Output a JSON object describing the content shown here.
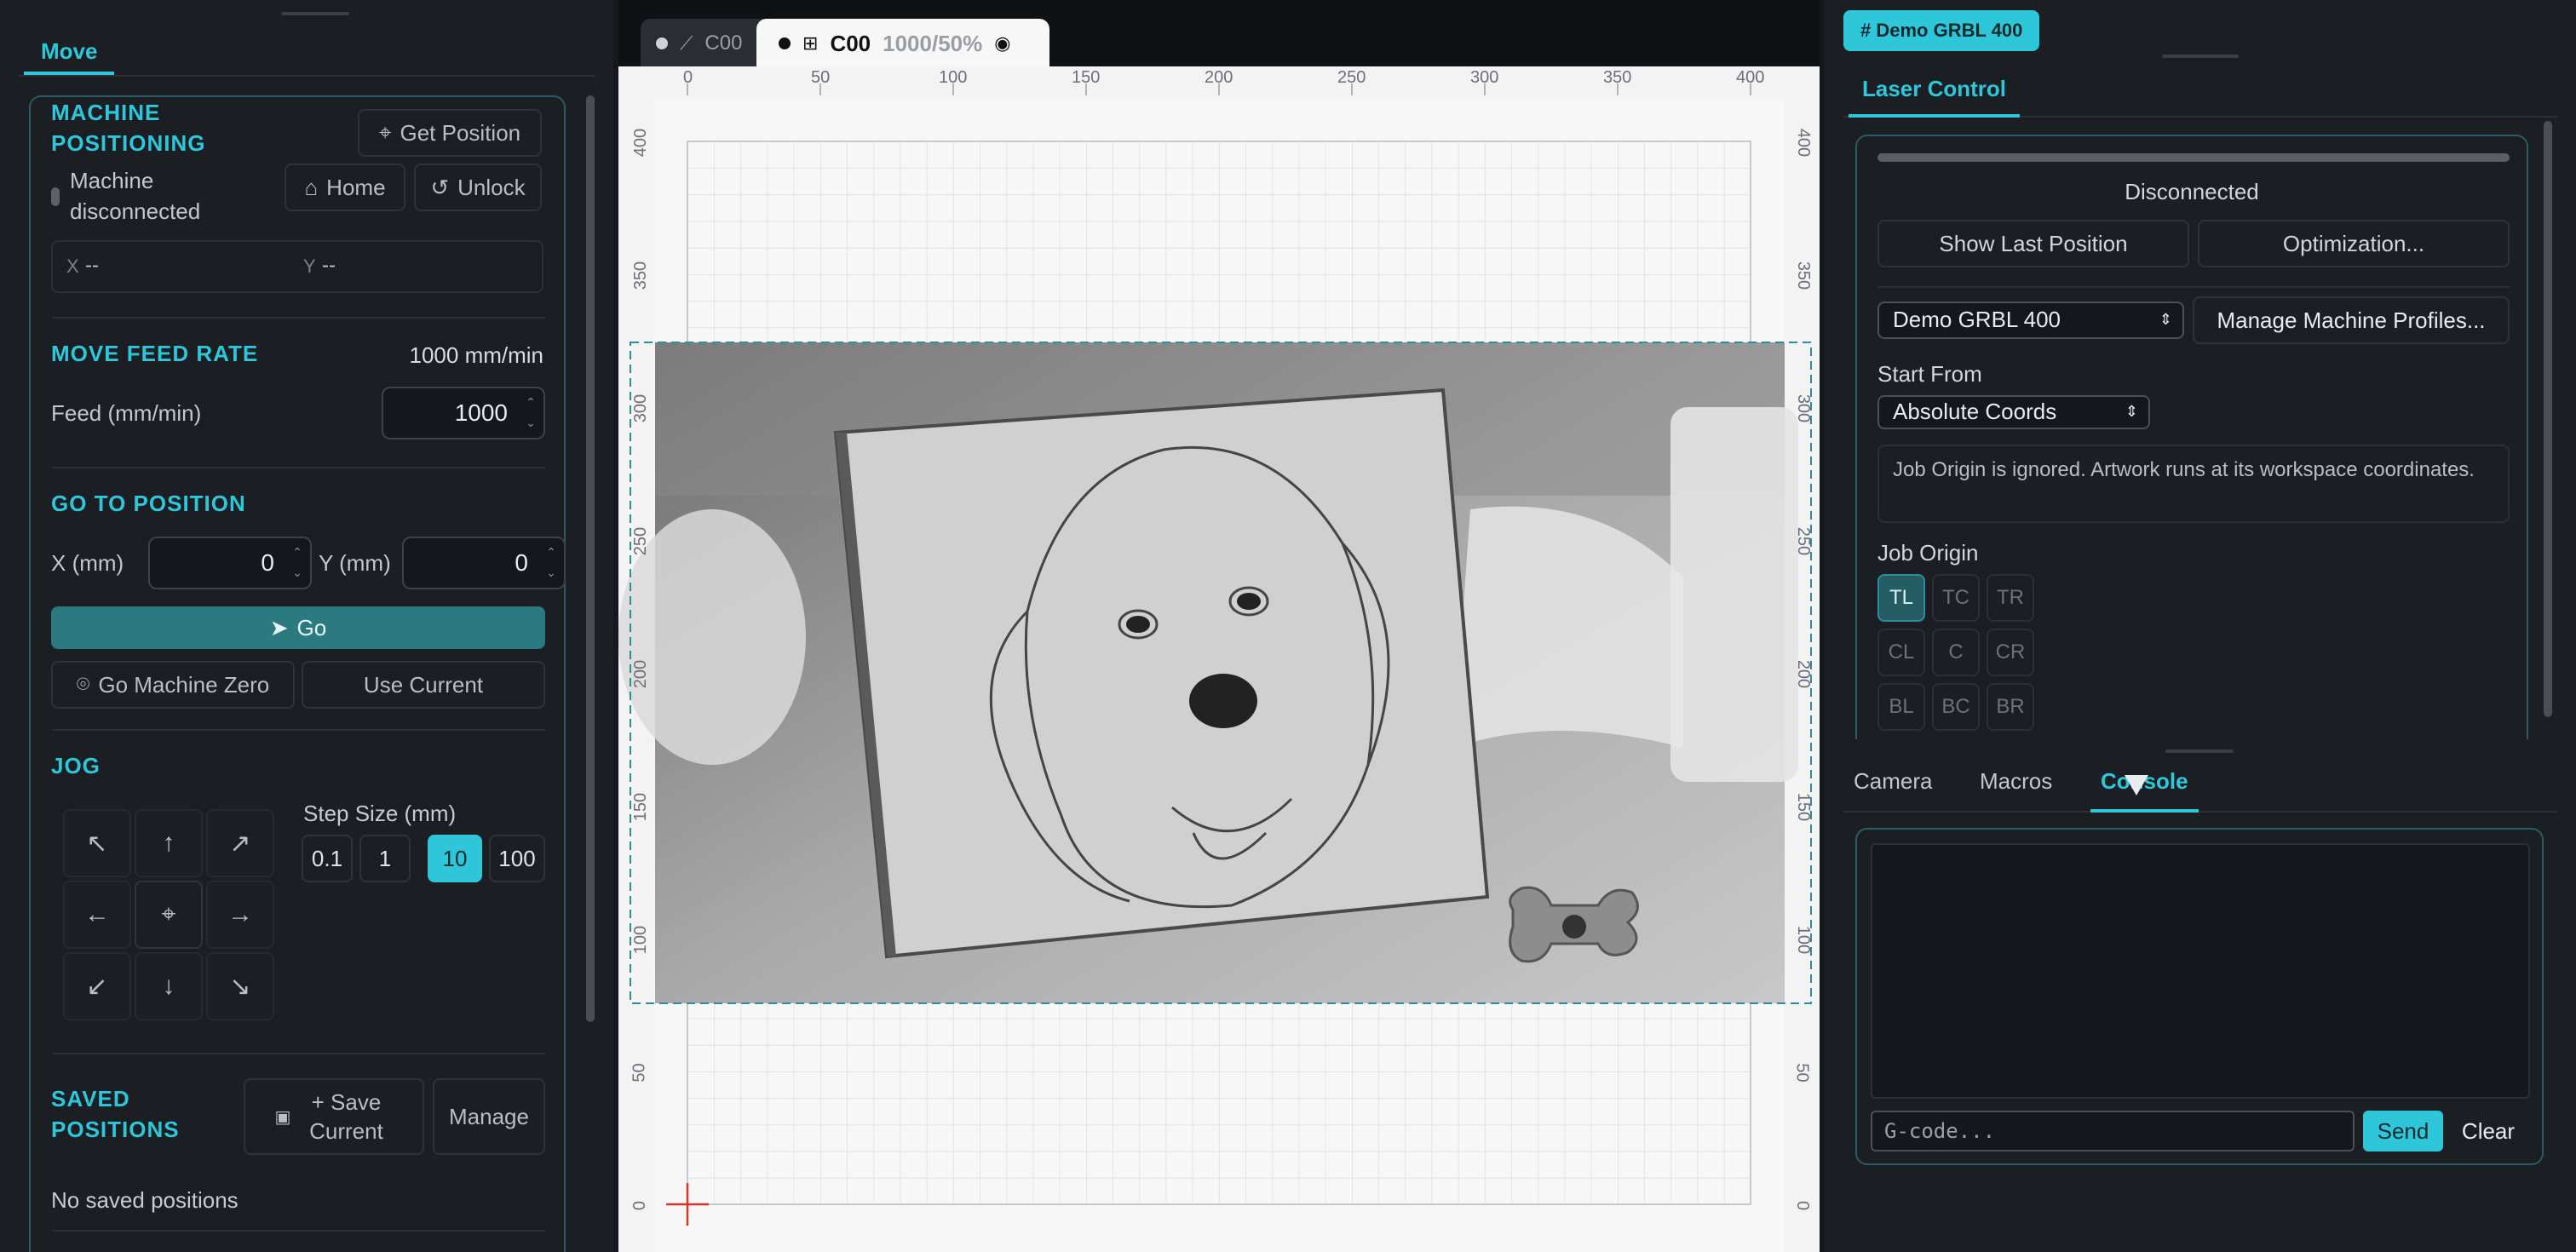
{
  "left": {
    "tab": "Move",
    "machine": {
      "title": "MACHINE POSITIONING",
      "get_position": "Get Position",
      "status": "Machine disconnected",
      "home": "Home",
      "unlock": "Unlock",
      "x_label": "X",
      "x_value": "--",
      "y_label": "Y",
      "y_value": "--"
    },
    "feed": {
      "title": "MOVE FEED RATE",
      "current": "1000 mm/min",
      "label": "Feed (mm/min)",
      "value": "1000"
    },
    "goto": {
      "title": "GO TO POSITION",
      "x_label": "X (mm)",
      "x_value": "0",
      "y_label": "Y (mm)",
      "y_value": "0",
      "go": "Go",
      "go_zero": "Go Machine Zero",
      "use_current": "Use Current"
    },
    "jog": {
      "title": "JOG",
      "step_label": "Step Size (mm)",
      "steps": [
        "0.1",
        "1",
        "10",
        "100"
      ],
      "active_step": "10"
    },
    "saved": {
      "title": "SAVED POSITIONS",
      "save": "+ Save Current",
      "manage": "Manage",
      "empty": "No saved positions"
    }
  },
  "center": {
    "tabs": [
      {
        "label": "C00"
      },
      {
        "label": "C00",
        "info": "1000/50%"
      }
    ],
    "ruler_x": [
      "0",
      "50",
      "100",
      "150",
      "200",
      "250",
      "300",
      "350",
      "400"
    ],
    "ruler_y": [
      "400",
      "350",
      "300",
      "250",
      "200",
      "150",
      "100",
      "50",
      "0"
    ]
  },
  "right": {
    "profile_tag": "# Demo GRBL 400",
    "tab": "Laser Control",
    "status": "Disconnected",
    "show_last": "Show Last Position",
    "optimization": "Optimization...",
    "profile_select": "Demo GRBL 400",
    "manage_profiles": "Manage Machine Profiles...",
    "start_from_label": "Start From",
    "start_from_value": "Absolute Coords",
    "info": "Job Origin is ignored. Artwork runs at its workspace coordinates.",
    "job_origin_label": "Job Origin",
    "origins": [
      "TL",
      "TC",
      "TR",
      "CL",
      "C",
      "CR",
      "BL",
      "BC",
      "BR"
    ],
    "bottom_tabs": [
      "Camera",
      "Macros",
      "Console"
    ],
    "gcode_placeholder": "G-code...",
    "send": "Send",
    "clear": "Clear"
  },
  "colors": {
    "accent": "#2ec7d9",
    "panel_border": "#2b5c63",
    "bg": "#15181d"
  }
}
